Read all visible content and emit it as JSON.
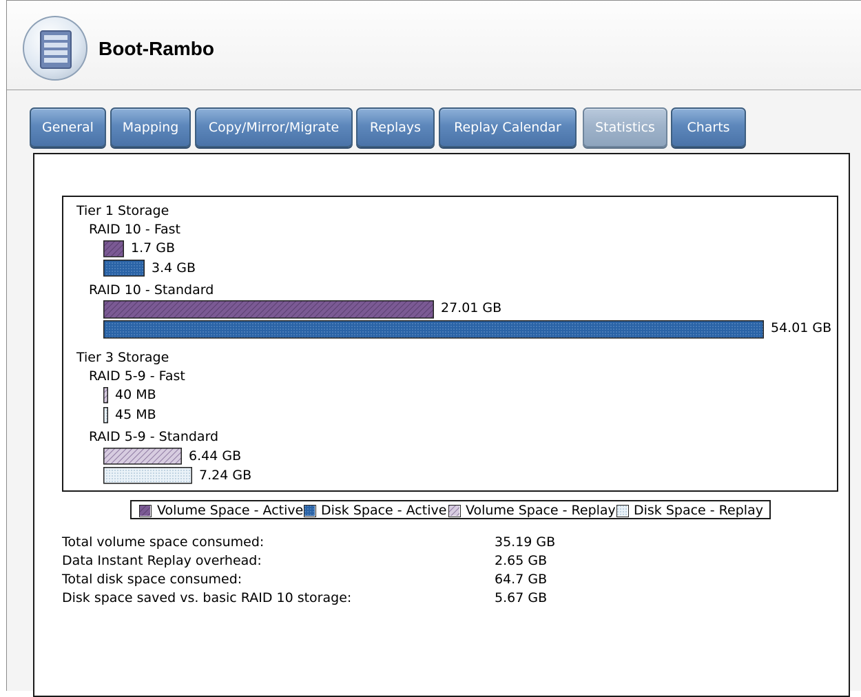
{
  "window": {
    "title": "Boot-Rambo"
  },
  "tabs": [
    {
      "label": "General",
      "active": false
    },
    {
      "label": "Mapping",
      "active": false
    },
    {
      "label": "Copy/Mirror/Migrate",
      "active": false
    },
    {
      "label": "Replays",
      "active": false
    },
    {
      "label": "Replay Calendar",
      "active": false
    },
    {
      "label": "Statistics",
      "active": true
    },
    {
      "label": "Charts",
      "active": false
    }
  ],
  "chart_data": {
    "type": "bar",
    "orientation": "horizontal",
    "unit": "GB",
    "groups": [
      {
        "tier": "Tier 1 Storage",
        "raid": [
          {
            "name": "RAID 10 - Fast",
            "bars": [
              {
                "series": "Volume Space - Active",
                "value": 1.7,
                "label": "1.7 GB"
              },
              {
                "series": "Disk Space - Active",
                "value": 3.4,
                "label": "3.4 GB"
              }
            ]
          },
          {
            "name": "RAID 10 - Standard",
            "bars": [
              {
                "series": "Volume Space - Active",
                "value": 27.01,
                "label": "27.01 GB"
              },
              {
                "series": "Disk Space - Active",
                "value": 54.01,
                "label": "54.01 GB"
              }
            ]
          }
        ]
      },
      {
        "tier": "Tier 3 Storage",
        "raid": [
          {
            "name": "RAID 5-9 - Fast",
            "bars": [
              {
                "series": "Volume Space - Replay",
                "value": 0.04,
                "label": "40 MB"
              },
              {
                "series": "Disk Space - Replay",
                "value": 0.045,
                "label": "45 MB"
              }
            ]
          },
          {
            "name": "RAID 5-9 - Standard",
            "bars": [
              {
                "series": "Volume Space - Replay",
                "value": 6.44,
                "label": "6.44 GB"
              },
              {
                "series": "Disk Space - Replay",
                "value": 7.24,
                "label": "7.24 GB"
              }
            ]
          }
        ]
      }
    ],
    "legend": [
      {
        "name": "Volume Space - Active",
        "color": "#7b5a94",
        "pattern": "diagonal"
      },
      {
        "name": "Disk Space - Active",
        "color": "#2a63a6",
        "pattern": "dots"
      },
      {
        "name": "Volume Space - Replay",
        "color": "#c2b3ce",
        "pattern": "diagonal"
      },
      {
        "name": "Disk Space - Replay",
        "color": "#d9e8f3",
        "pattern": "dots"
      }
    ],
    "legend_position": "bottom-center",
    "xlim": [
      0,
      54.01
    ]
  },
  "summary": [
    {
      "label": "Total volume space consumed:",
      "value": "35.19 GB"
    },
    {
      "label": "Data Instant Replay overhead:",
      "value": "2.65 GB"
    },
    {
      "label": "Total disk space consumed:",
      "value": "64.7 GB"
    },
    {
      "label": "Disk space saved vs. basic RAID 10 storage:",
      "value": "5.67 GB"
    }
  ]
}
